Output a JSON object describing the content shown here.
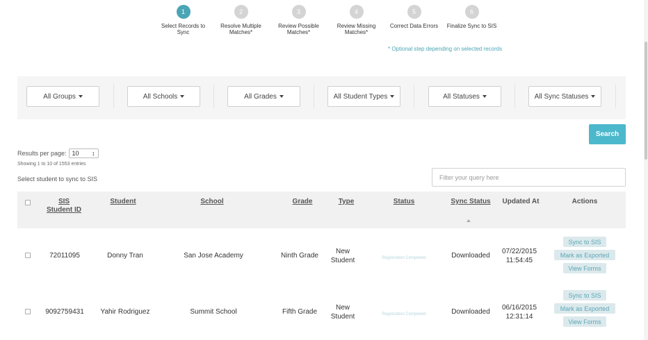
{
  "steps": [
    {
      "number": "1",
      "label": "Select Records to Sync"
    },
    {
      "number": "2",
      "label": "Resolve Multiple Matches*"
    },
    {
      "number": "3",
      "label": "Review Possible Matches*"
    },
    {
      "number": "4",
      "label": "Review Missing Matches*"
    },
    {
      "number": "5",
      "label": "Correct Data Errors"
    },
    {
      "number": "6",
      "label": "Finalize Sync to SIS"
    }
  ],
  "optional_note": "* Optional step depending on selected records",
  "filters": {
    "groups": "All Groups",
    "schools": "All Schools",
    "grades": "All Grades",
    "student_types": "All Student Types",
    "statuses": "All Statuses",
    "sync_statuses": "All Sync Statuses"
  },
  "search_label": "Search",
  "results_per_page": {
    "label": "Results per page:",
    "value": "10",
    "arrows": "↕"
  },
  "showing_text": "Showing 1 to 10 of 1553 entries",
  "select_label": "Select student to sync to SIS",
  "query_placeholder": "Filter your query here",
  "columns": {
    "sis_id": "SIS Student ID",
    "student": "Student",
    "school": "School",
    "grade": "Grade",
    "type": "Type",
    "status": "Status",
    "sync_status": "Sync Status",
    "updated_at": "Updated At",
    "actions": "Actions"
  },
  "rows": [
    {
      "sis_id": "72011095",
      "student": "Donny Tran",
      "school": "San Jose Academy",
      "grade": "Ninth Grade",
      "type": "New Student",
      "status": "Registration Completed",
      "sync_status": "Downloaded",
      "updated_at": "07/22/2015 11:54:45",
      "actions": [
        "Sync to SIS",
        "Mark as Exported",
        "View Forms"
      ]
    },
    {
      "sis_id": "9092759431",
      "student": "Yahir Rodriguez",
      "school": "Summit School",
      "grade": "Fifth Grade",
      "type": "New Student",
      "status": "Registration Completed",
      "sync_status": "Downloaded",
      "updated_at": "06/16/2015 12:31:14",
      "actions": [
        "Sync to SIS",
        "Mark as Exported",
        "View Forms"
      ]
    }
  ],
  "colors": {
    "accent": "#4aa5b4",
    "search_button": "#4cb8cc",
    "action_bg": "#dce9ec"
  }
}
